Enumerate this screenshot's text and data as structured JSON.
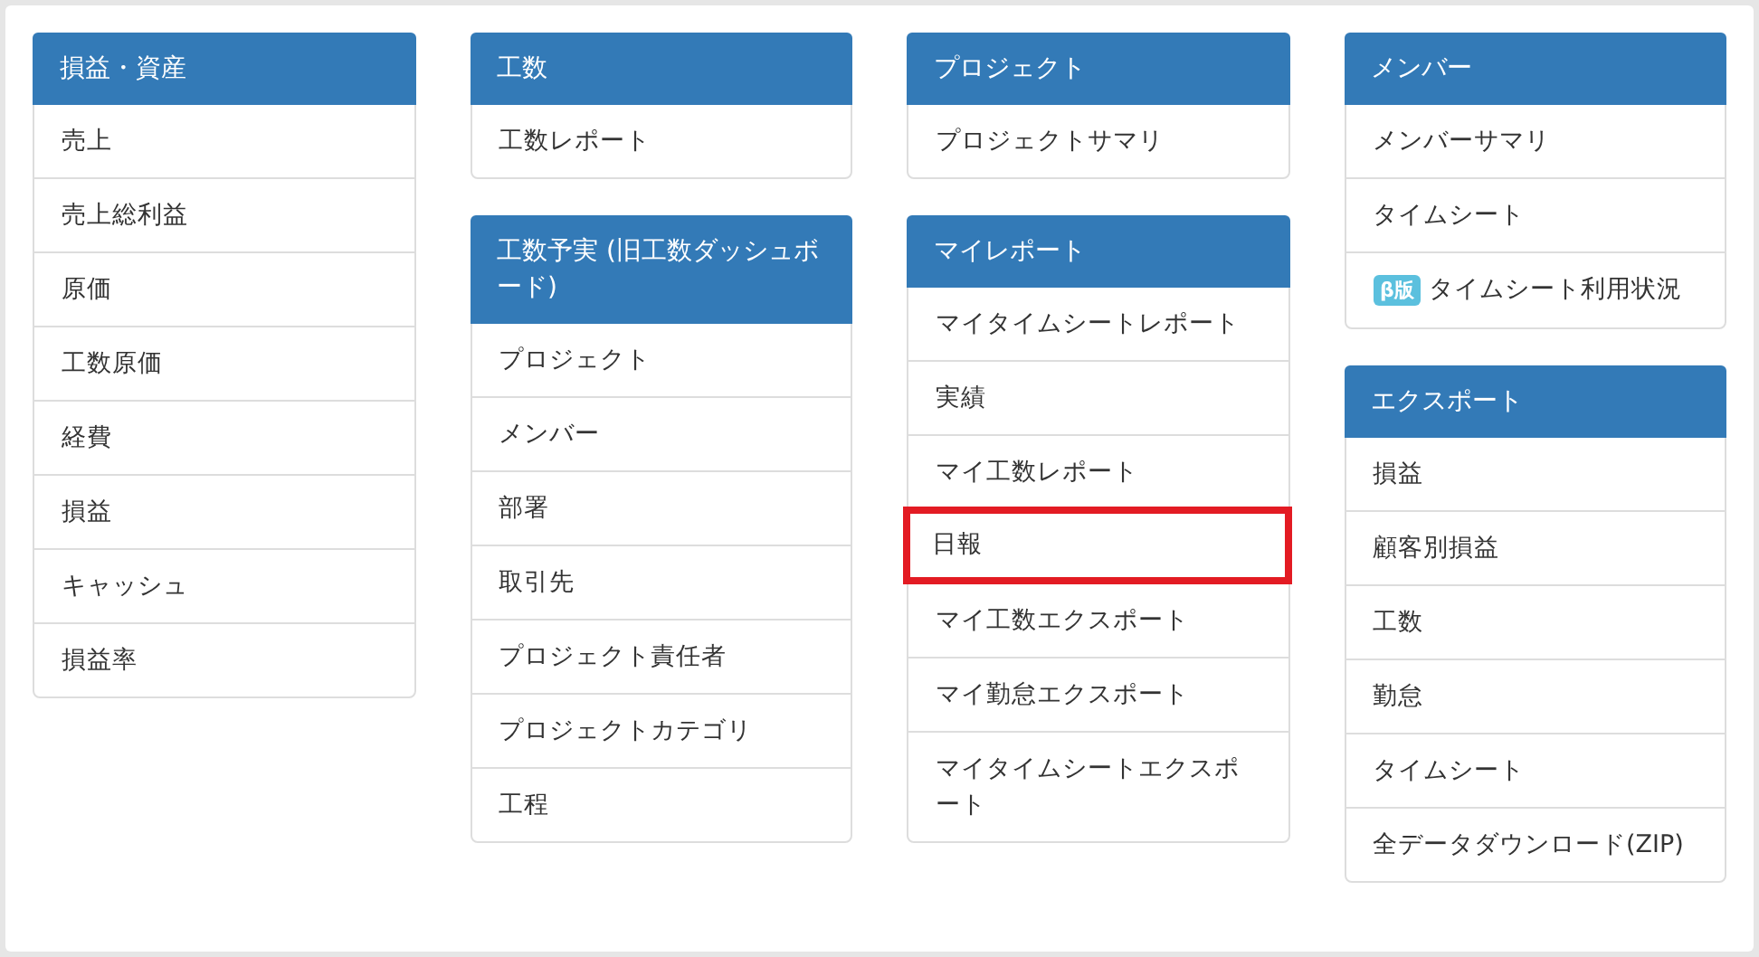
{
  "columns": [
    {
      "panels": [
        {
          "title": "損益・資産",
          "items": [
            {
              "label": "売上",
              "highlighted": false
            },
            {
              "label": "売上総利益",
              "highlighted": false
            },
            {
              "label": "原価",
              "highlighted": false
            },
            {
              "label": "工数原価",
              "highlighted": false
            },
            {
              "label": "経費",
              "highlighted": false
            },
            {
              "label": "損益",
              "highlighted": false
            },
            {
              "label": "キャッシュ",
              "highlighted": false
            },
            {
              "label": "損益率",
              "highlighted": false
            }
          ]
        }
      ]
    },
    {
      "panels": [
        {
          "title": "工数",
          "items": [
            {
              "label": "工数レポート",
              "highlighted": false
            }
          ]
        },
        {
          "title": "工数予実 (旧工数ダッシュボード)",
          "items": [
            {
              "label": "プロジェクト",
              "highlighted": false
            },
            {
              "label": "メンバー",
              "highlighted": false
            },
            {
              "label": "部署",
              "highlighted": false
            },
            {
              "label": "取引先",
              "highlighted": false
            },
            {
              "label": "プロジェクト責任者",
              "highlighted": false
            },
            {
              "label": "プロジェクトカテゴリ",
              "highlighted": false
            },
            {
              "label": "工程",
              "highlighted": false
            }
          ]
        }
      ]
    },
    {
      "panels": [
        {
          "title": "プロジェクト",
          "items": [
            {
              "label": "プロジェクトサマリ",
              "highlighted": false
            }
          ]
        },
        {
          "title": "マイレポート",
          "items": [
            {
              "label": "マイタイムシートレポート",
              "highlighted": false
            },
            {
              "label": "実績",
              "highlighted": false
            },
            {
              "label": "マイ工数レポート",
              "highlighted": false
            },
            {
              "label": "日報",
              "highlighted": true
            },
            {
              "label": "マイ工数エクスポート",
              "highlighted": false
            },
            {
              "label": "マイ勤怠エクスポート",
              "highlighted": false
            },
            {
              "label": "マイタイムシートエクスポート",
              "highlighted": false
            }
          ]
        }
      ]
    },
    {
      "panels": [
        {
          "title": "メンバー",
          "items": [
            {
              "label": "メンバーサマリ",
              "highlighted": false
            },
            {
              "label": "タイムシート",
              "highlighted": false
            },
            {
              "label": "タイムシート利用状況",
              "badge": "β版",
              "highlighted": false
            }
          ]
        },
        {
          "title": "エクスポート",
          "items": [
            {
              "label": "損益",
              "highlighted": false
            },
            {
              "label": "顧客別損益",
              "highlighted": false
            },
            {
              "label": "工数",
              "highlighted": false
            },
            {
              "label": "勤怠",
              "highlighted": false
            },
            {
              "label": "タイムシート",
              "highlighted": false
            },
            {
              "label": "全データダウンロード(ZIP)",
              "highlighted": false
            }
          ]
        }
      ]
    }
  ]
}
